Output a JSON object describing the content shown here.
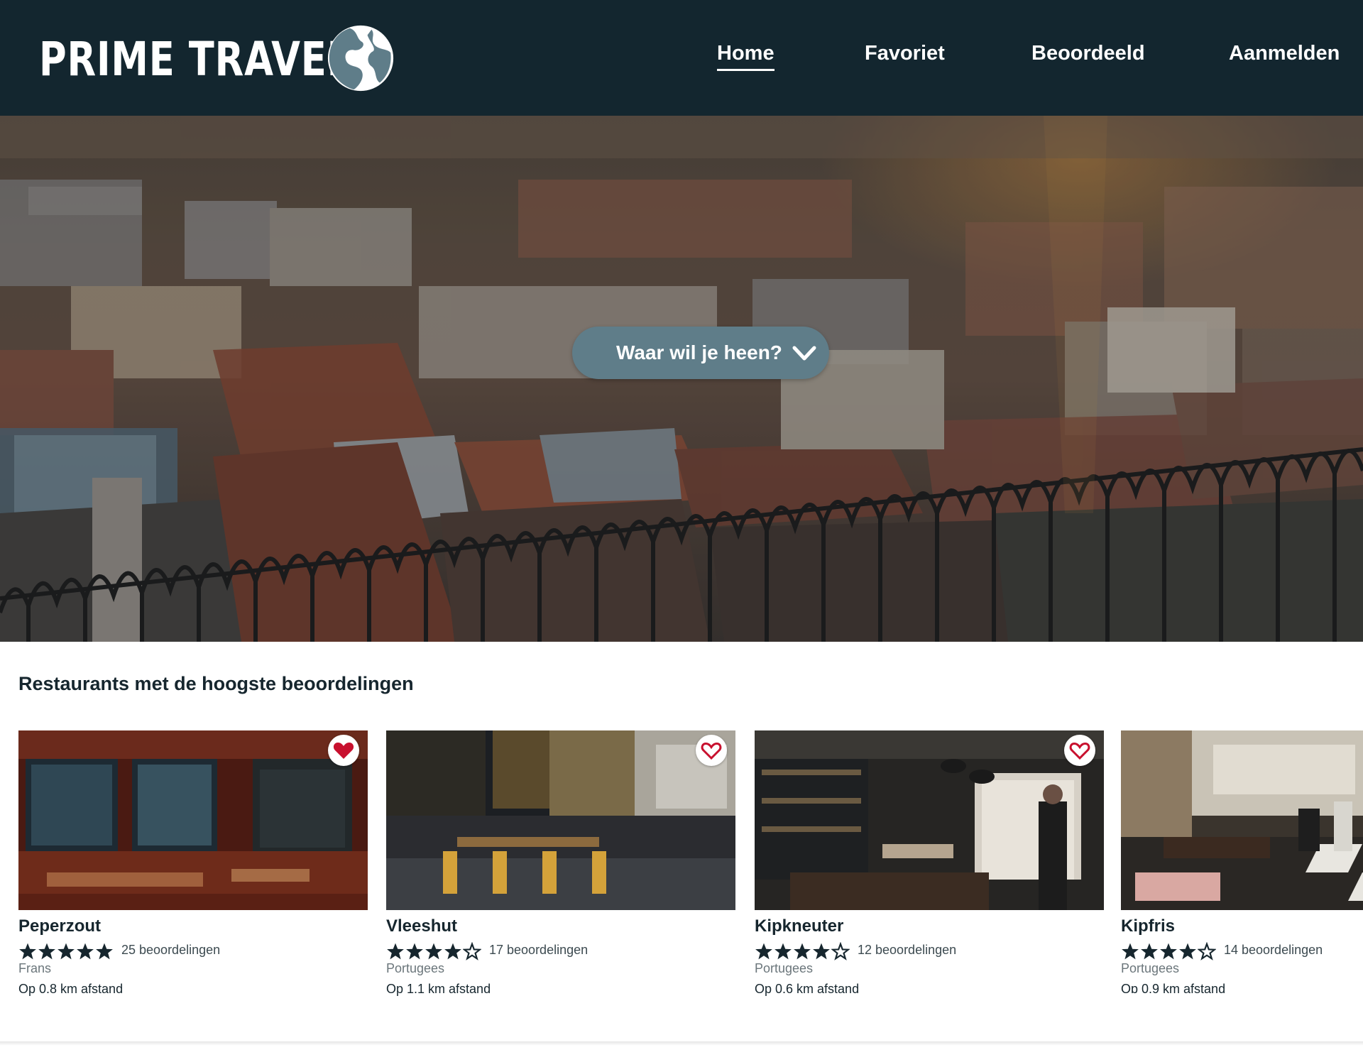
{
  "brand": {
    "name": "PRIME TRAVELS",
    "logo_icon": "globe-icon"
  },
  "nav": {
    "items": [
      {
        "label": "Home",
        "active": true
      },
      {
        "label": "Favoriet",
        "active": false
      },
      {
        "label": "Beoordeeld",
        "active": false
      },
      {
        "label": "Aanmelden",
        "active": false
      }
    ]
  },
  "hero": {
    "dropdown_label": "Waar wil je heen?",
    "dropdown_icon": "chevron-down-icon"
  },
  "section": {
    "title": "Restaurants met de hoogste beoordelingen"
  },
  "restaurants": [
    {
      "name": "Peperzout",
      "rating": 5,
      "reviews": "25 beoordelingen",
      "cuisine": "Frans",
      "distance": "Op 0.8 km afstand",
      "favorite": true
    },
    {
      "name": "Vleeshut",
      "rating": 4,
      "reviews": "17 beoordelingen",
      "cuisine": "Portugees",
      "distance": "Op 1.1 km afstand",
      "favorite": false
    },
    {
      "name": "Kipkneuter",
      "rating": 4,
      "reviews": "12 beoordelingen",
      "cuisine": "Portugees",
      "distance": "Op 0.6 km afstand",
      "favorite": false
    },
    {
      "name": "Kipfris",
      "rating": 4,
      "reviews": "14 beoordelingen",
      "cuisine": "Portugees",
      "distance": "Op 0.9 km afstand",
      "favorite": false
    }
  ],
  "colors": {
    "header_bg": "#13262f",
    "dropdown_bg": "#5f7d89",
    "heart_red": "#c8102e",
    "star": "#16262e"
  }
}
